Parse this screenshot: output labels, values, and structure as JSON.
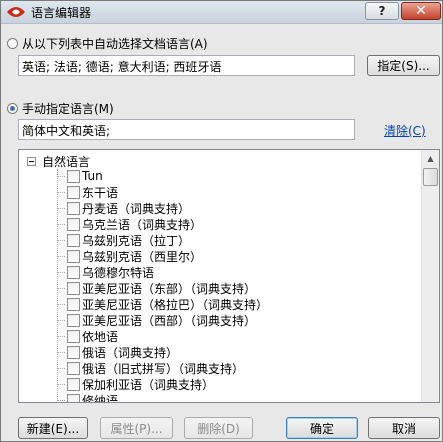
{
  "window": {
    "title": "语言编辑器",
    "help_label": "?",
    "close_label": "✕"
  },
  "auto": {
    "option_label": "从以下列表中自动选择文档语言(A)",
    "languages_value": "英语; 法语; 德语; 意大利语; 西班牙语",
    "specify_button": "指定(S)..."
  },
  "manual": {
    "option_label": "手动指定语言(M)",
    "languages_value": "简体中文和英语;",
    "clear_link": "清除(C)"
  },
  "tree": {
    "root_label": "自然语言",
    "items": [
      "Tun",
      "东干语",
      "丹麦语（词典支持）",
      "乌克兰语（词典支持）",
      "乌兹别克语（拉丁）",
      "乌兹别克语（西里尔）",
      "乌德穆尔特语",
      "亚美尼亚语（东部）（词典支持）",
      "亚美尼亚语（格拉巴）（词典支持）",
      "亚美尼亚语（西部）（词典支持）",
      "依地语",
      "俄语（词典支持）",
      "俄语（旧式拼写）（词典支持）",
      "保加利亚语（词典支持）",
      "修纳语"
    ]
  },
  "buttons": {
    "new": "新建(E)...",
    "properties": "属性(P)...",
    "delete": "删除(D)",
    "ok": "确定",
    "cancel": "取消"
  },
  "colors": {
    "accent": "#3a6fb8",
    "link": "#0645ad",
    "close": "#c7422b"
  }
}
